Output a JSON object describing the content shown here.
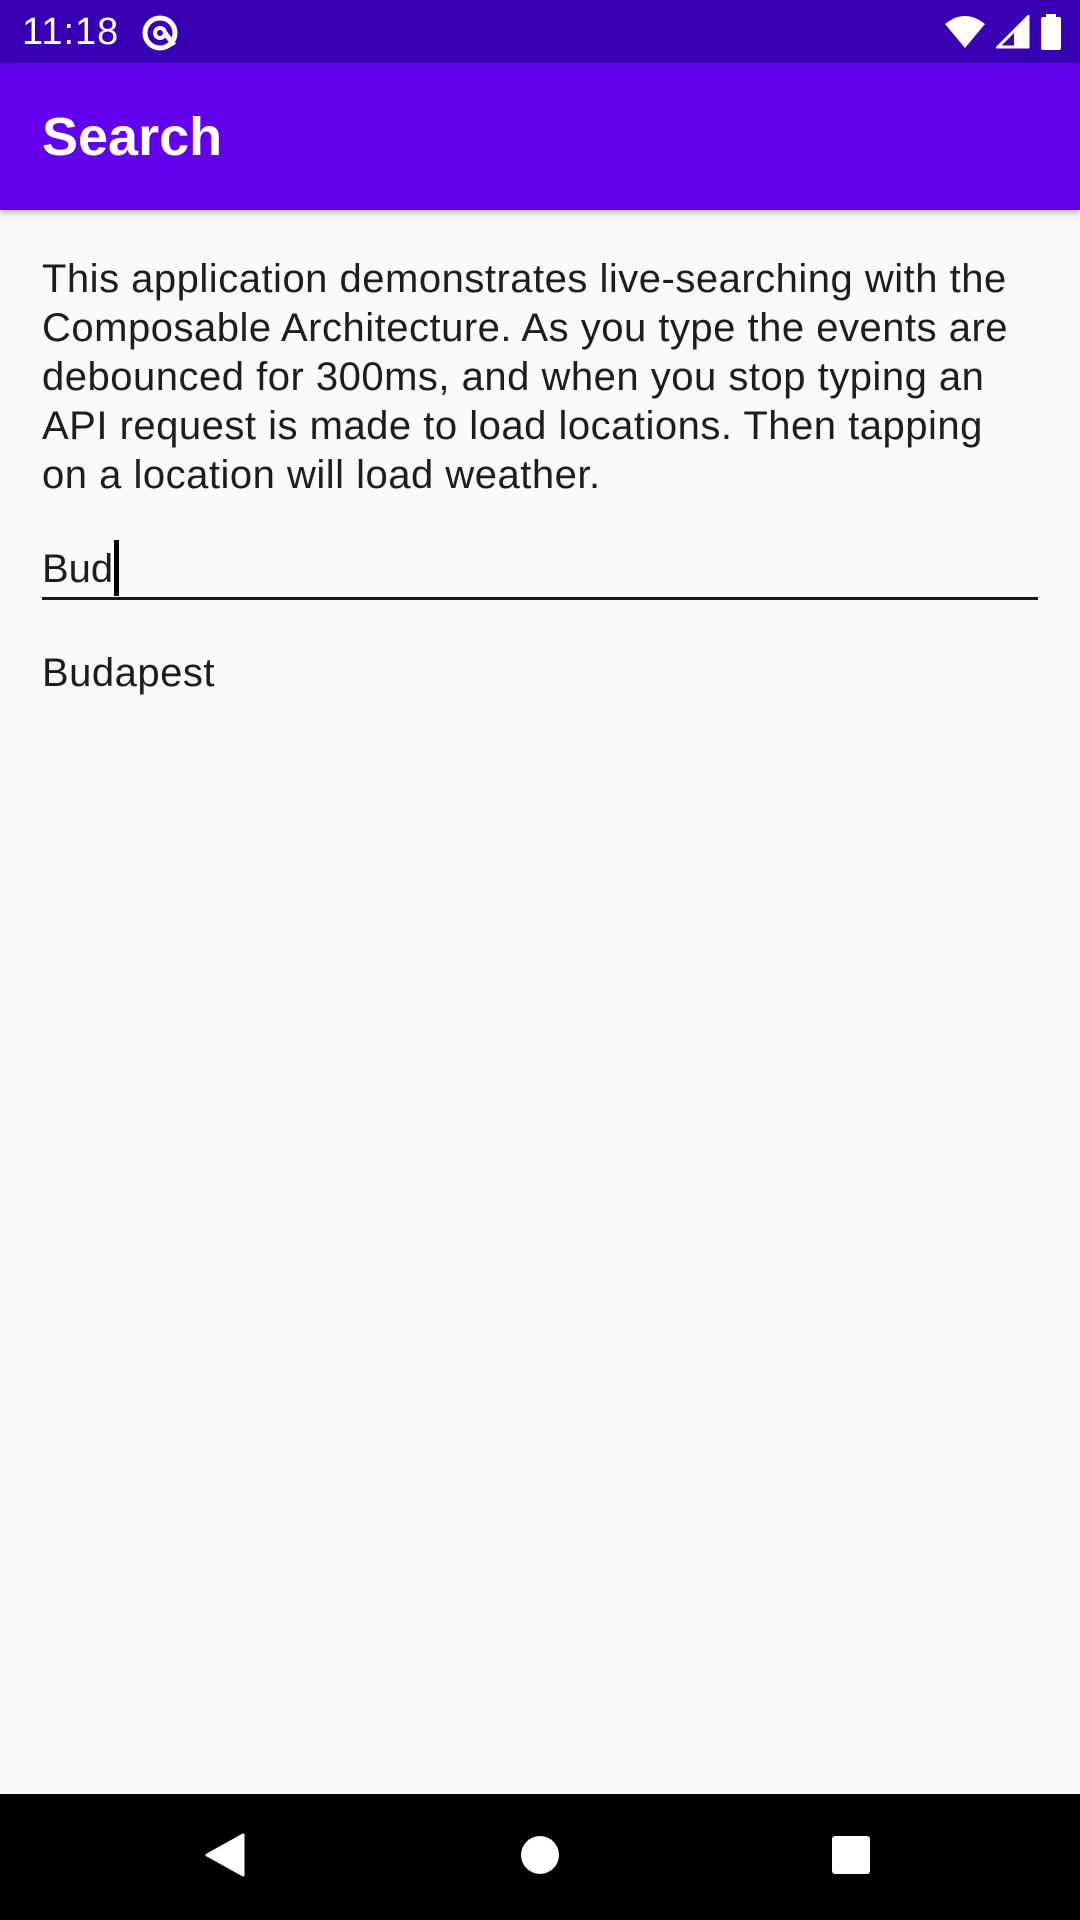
{
  "status_bar": {
    "time": "11:18",
    "app_icon": "at-sign-icon",
    "icons": [
      "wifi-icon",
      "cellular-signal-icon",
      "battery-icon"
    ]
  },
  "app_bar": {
    "title": "Search"
  },
  "main": {
    "description": "This application demonstrates live-searching with the Composable Architecture. As you type the events are debounced for 300ms, and when you stop typing an API request is made to load locations. Then tapping on a location will load weather.",
    "search": {
      "value": "Bud",
      "placeholder": ""
    },
    "results": [
      {
        "label": "Budapest"
      }
    ]
  },
  "nav_bar": {
    "buttons": [
      "back-icon",
      "home-icon",
      "recents-icon"
    ]
  },
  "colors": {
    "status_bar": "#3700b3",
    "app_bar": "#6200ee",
    "background": "#fafafa",
    "nav_bar": "#000000"
  }
}
